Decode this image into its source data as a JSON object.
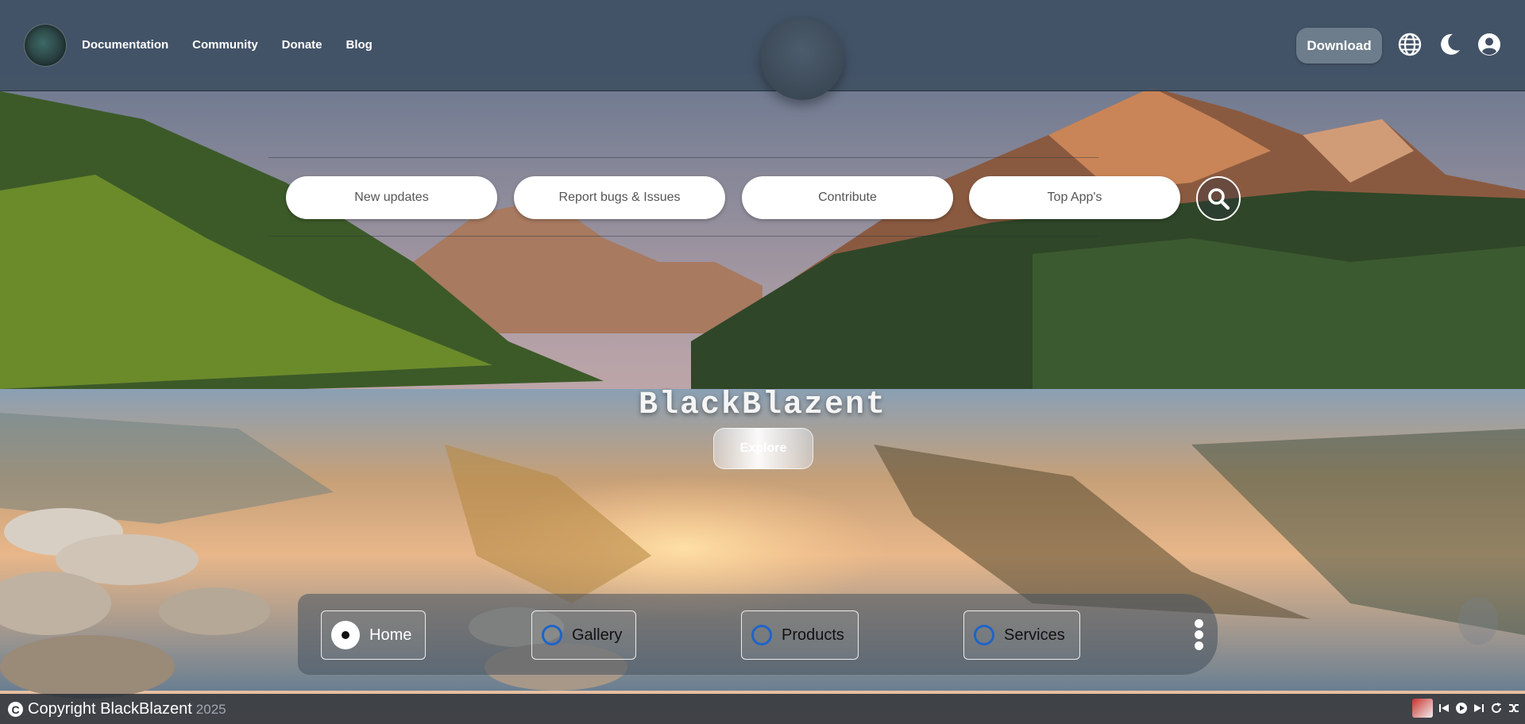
{
  "nav": {
    "links": [
      "Documentation",
      "Community",
      "Donate",
      "Blog"
    ],
    "download_label": "Download",
    "icons": [
      "globe-icon",
      "moon-icon",
      "user-icon"
    ]
  },
  "quick_links": {
    "pills": [
      "New updates",
      "Report bugs & Issues",
      "Contribute",
      "Top App's"
    ],
    "search_icon": "search-icon"
  },
  "hero": {
    "title": "BlackBlazent",
    "explore_label": "Explore"
  },
  "dock": {
    "items": [
      {
        "label": "Home",
        "active": true
      },
      {
        "label": "Gallery",
        "active": false
      },
      {
        "label": "Products",
        "active": false
      },
      {
        "label": "Services",
        "active": false
      }
    ],
    "more_icon": "kebab-menu-icon"
  },
  "footer": {
    "copyright_text": "Copyright BlackBlazent",
    "year": "2025",
    "media_controls": [
      "previous-icon",
      "play-icon",
      "next-icon",
      "repeat-icon",
      "shuffle-icon"
    ]
  },
  "colors": {
    "topbar": "#404f64",
    "accent_ring": "#1e64c8",
    "download_bg": "#6d7d8c"
  }
}
